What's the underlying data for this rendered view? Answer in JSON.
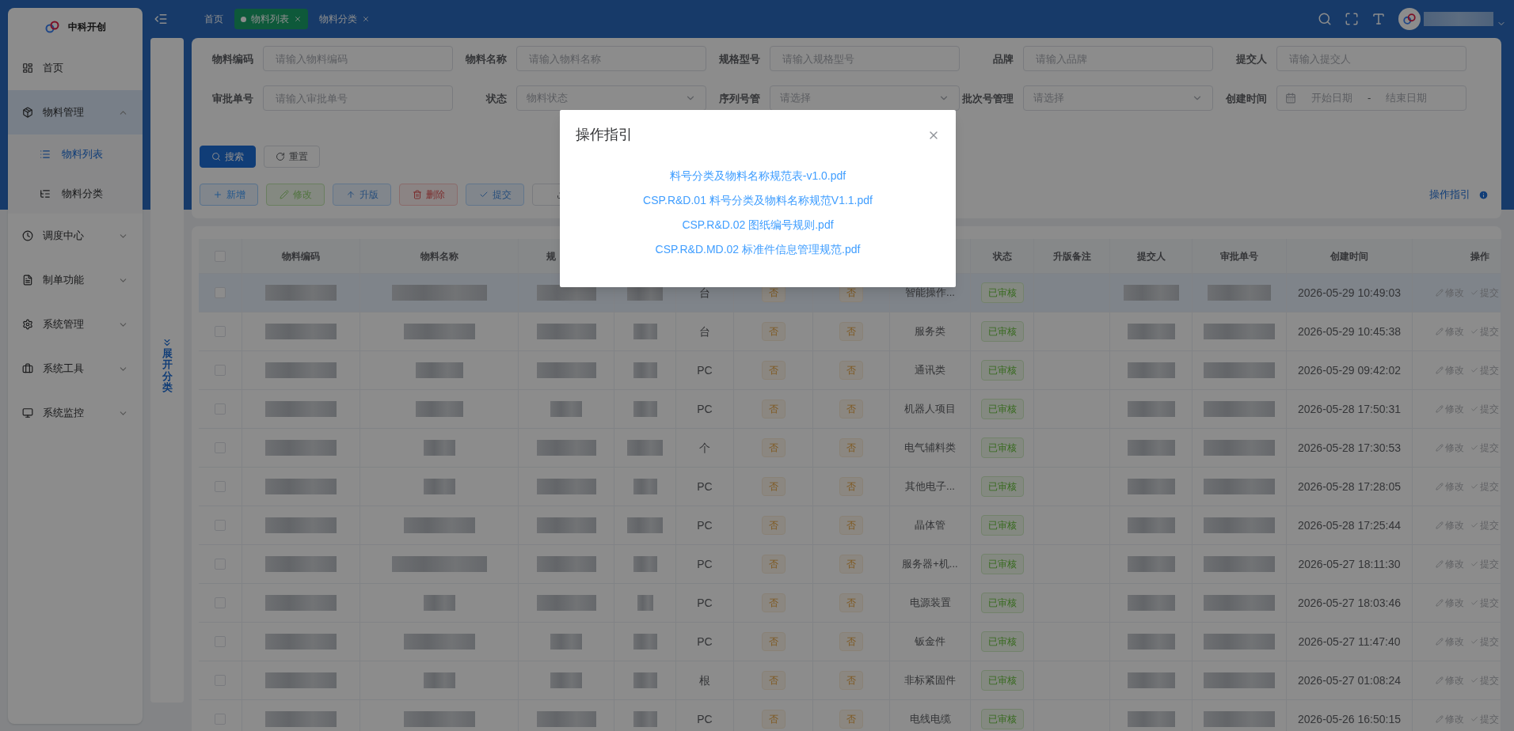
{
  "sidebar": {
    "brand": "中科开创",
    "items": [
      {
        "label": "首页",
        "selected": false
      },
      {
        "label": "物料管理",
        "expanded": true,
        "selected": true,
        "children": [
          {
            "label": "物料列表",
            "selected": true
          },
          {
            "label": "物料分类",
            "selected": false
          }
        ]
      },
      {
        "label": "调度中心",
        "expanded": false,
        "selected": false
      },
      {
        "label": "制单功能",
        "expanded": false,
        "selected": false
      },
      {
        "label": "系统管理",
        "expanded": false,
        "selected": false
      },
      {
        "label": "系统工具",
        "expanded": false,
        "selected": false
      },
      {
        "label": "系统监控",
        "expanded": false,
        "selected": false
      }
    ]
  },
  "tabs": [
    {
      "label": "首页",
      "selected": false,
      "closable": false
    },
    {
      "label": "物料列表",
      "selected": true,
      "closable": true
    },
    {
      "label": "物料分类",
      "selected": false,
      "closable": true
    }
  ],
  "category_toggle": {
    "label": "展开分类"
  },
  "filters": [
    {
      "label": "物料编码",
      "kind": "input",
      "placeholder": "请输入物料编码"
    },
    {
      "label": "物料名称",
      "kind": "input",
      "placeholder": "请输入物料名称"
    },
    {
      "label": "规格型号",
      "kind": "input",
      "placeholder": "请输入规格型号"
    },
    {
      "label": "品牌",
      "kind": "input",
      "placeholder": "请输入品牌"
    },
    {
      "label": "提交人",
      "kind": "input",
      "placeholder": "请输入提交人"
    },
    {
      "label": "审批单号",
      "kind": "input",
      "placeholder": "请输入审批单号"
    },
    {
      "label": "状态",
      "kind": "select",
      "placeholder": "物料状态"
    },
    {
      "label": "序列号管",
      "kind": "select",
      "placeholder": "请选择"
    },
    {
      "label": "批次号管理",
      "kind": "select",
      "placeholder": "请选择"
    },
    {
      "label": "创建时间",
      "kind": "daterange",
      "placeholder": "开始日期",
      "placeholder_end": "结束日期",
      "separator": "-"
    }
  ],
  "search_buttons": [
    {
      "label": "搜索",
      "kind": "primary"
    },
    {
      "label": "重置",
      "kind": "reset"
    }
  ],
  "toolbar": [
    {
      "label": "新增",
      "kind": "add"
    },
    {
      "label": "修改",
      "kind": "edit"
    },
    {
      "label": "升版",
      "kind": "upgrade"
    },
    {
      "label": "删除",
      "kind": "delete"
    },
    {
      "label": "提交",
      "kind": "submit"
    },
    {
      "kind": "export"
    }
  ],
  "guide_link": "操作指引",
  "table": {
    "columns": [
      {
        "kind": "check",
        "checked": false
      },
      {
        "label": "物料编码"
      },
      {
        "label": "物料名称"
      },
      {
        "label": "规"
      },
      {},
      {},
      {},
      {},
      {},
      {
        "label": "状态"
      },
      {
        "label": "升版备注"
      },
      {
        "label": "提交人"
      },
      {
        "label": "审批单号"
      },
      {
        "label": "创建时间"
      },
      {
        "label": "操作"
      }
    ],
    "rows": [
      {
        "selected": true,
        "unit": "台",
        "column_7": "否",
        "column_8": "否",
        "category": "智能操作...",
        "status": "已审核",
        "created": "2026-05-29 10:49:03",
        "actions": [
          "修改",
          "提交"
        ]
      },
      {
        "selected": false,
        "unit": "台",
        "column_7": "否",
        "column_8": "否",
        "category": "服务类",
        "status": "已审核",
        "created": "2026-05-29 10:45:38",
        "actions": [
          "修改",
          "提交"
        ]
      },
      {
        "selected": false,
        "unit": "PC",
        "column_7": "否",
        "column_8": "否",
        "category": "通讯类",
        "status": "已审核",
        "created": "2026-05-29 09:42:02",
        "actions": [
          "修改",
          "提交"
        ]
      },
      {
        "selected": false,
        "unit": "PC",
        "column_7": "否",
        "column_8": "否",
        "category": "机器人项目",
        "status": "已审核",
        "created": "2026-05-28 17:50:31",
        "actions": [
          "修改",
          "提交"
        ]
      },
      {
        "selected": false,
        "unit": "个",
        "column_7": "否",
        "column_8": "否",
        "category": "电气辅料类",
        "status": "已审核",
        "created": "2026-05-28 17:30:53",
        "actions": [
          "修改",
          "提交"
        ]
      },
      {
        "selected": false,
        "unit": "PC",
        "column_7": "否",
        "column_8": "否",
        "category": "其他电子...",
        "status": "已审核",
        "created": "2026-05-28 17:28:05",
        "actions": [
          "修改",
          "提交"
        ]
      },
      {
        "selected": false,
        "unit": "PC",
        "column_7": "否",
        "column_8": "否",
        "category": "晶体管",
        "status": "已审核",
        "created": "2026-05-28 17:25:44",
        "actions": [
          "修改",
          "提交"
        ]
      },
      {
        "selected": false,
        "unit": "PC",
        "column_7": "否",
        "column_8": "否",
        "category": "服务器+机...",
        "status": "已审核",
        "created": "2026-05-27 18:11:30",
        "actions": [
          "修改",
          "提交"
        ]
      },
      {
        "selected": false,
        "unit": "PC",
        "column_7": "否",
        "column_8": "否",
        "category": "电源装置",
        "status": "已审核",
        "created": "2026-05-27 18:03:46",
        "actions": [
          "修改",
          "提交"
        ]
      },
      {
        "selected": false,
        "unit": "PC",
        "column_7": "否",
        "column_8": "否",
        "category": "钣金件",
        "status": "已审核",
        "created": "2026-05-27 11:47:40",
        "actions": [
          "修改",
          "提交"
        ]
      },
      {
        "selected": false,
        "unit": "根",
        "column_7": "否",
        "column_8": "否",
        "category": "非标紧固件",
        "status": "已审核",
        "created": "2026-05-27 01:08:24",
        "actions": [
          "修改",
          "提交"
        ]
      },
      {
        "selected": false,
        "unit": "PC",
        "column_7": "否",
        "column_8": "否",
        "category": "电线电缆",
        "status": "已审核",
        "created": "2026-05-26 16:50:15",
        "actions": [
          "修改",
          "提交"
        ]
      }
    ]
  },
  "dialog": {
    "title": "操作指引",
    "links": [
      "料号分类及物料名称规范表-v1.0.pdf",
      "CSP.R&D.01 料号分类及物料名称规范V1.1.pdf",
      "CSP.R&D.02 图纸编号规则.pdf",
      "CSP.R&D.MD.02 标准件信息管理规范.pdf"
    ]
  }
}
